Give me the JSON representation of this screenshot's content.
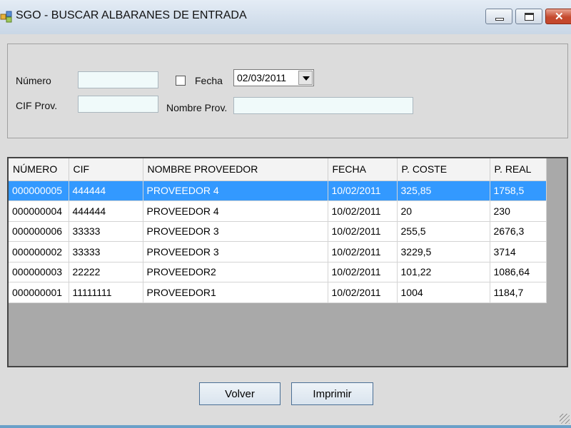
{
  "window": {
    "title": "SGO - BUSCAR ALBARANES DE ENTRADA",
    "buttons": {
      "minimize": "minimize-icon",
      "maximize": "maximize-icon",
      "close": "close-icon"
    }
  },
  "filters": {
    "numero_label": "Número",
    "numero_value": "",
    "fecha_label": "Fecha",
    "fecha_checked": false,
    "fecha_value": "02/03/2011",
    "cif_label": "CIF Prov.",
    "cif_value": "",
    "nombre_label": "Nombre Prov.",
    "nombre_value": ""
  },
  "grid": {
    "columns": [
      "NÚMERO",
      "CIF",
      "NOMBRE PROVEEDOR",
      "FECHA",
      "P. COSTE",
      "P. REAL"
    ],
    "selected_row": 0,
    "rows": [
      [
        "000000005",
        "444444",
        "PROVEEDOR 4",
        "10/02/2011",
        "325,85",
        "1758,5"
      ],
      [
        "000000004",
        "444444",
        "PROVEEDOR 4",
        "10/02/2011",
        "20",
        "230"
      ],
      [
        "000000006",
        "33333",
        "PROVEEDOR 3",
        "10/02/2011",
        "255,5",
        "2676,3"
      ],
      [
        "000000002",
        "33333",
        "PROVEEDOR 3",
        "10/02/2011",
        "3229,5",
        "3714"
      ],
      [
        "000000003",
        "22222",
        "PROVEEDOR2",
        "10/02/2011",
        "101,22",
        "1086,64"
      ],
      [
        "000000001",
        "11111111",
        "PROVEEDOR1",
        "10/02/2011",
        "1004",
        "1184,7"
      ]
    ]
  },
  "actions": {
    "volver": "Volver",
    "imprimir": "Imprimir"
  },
  "colors": {
    "selection": "#3399ff",
    "close_button": "#c54a2e"
  }
}
